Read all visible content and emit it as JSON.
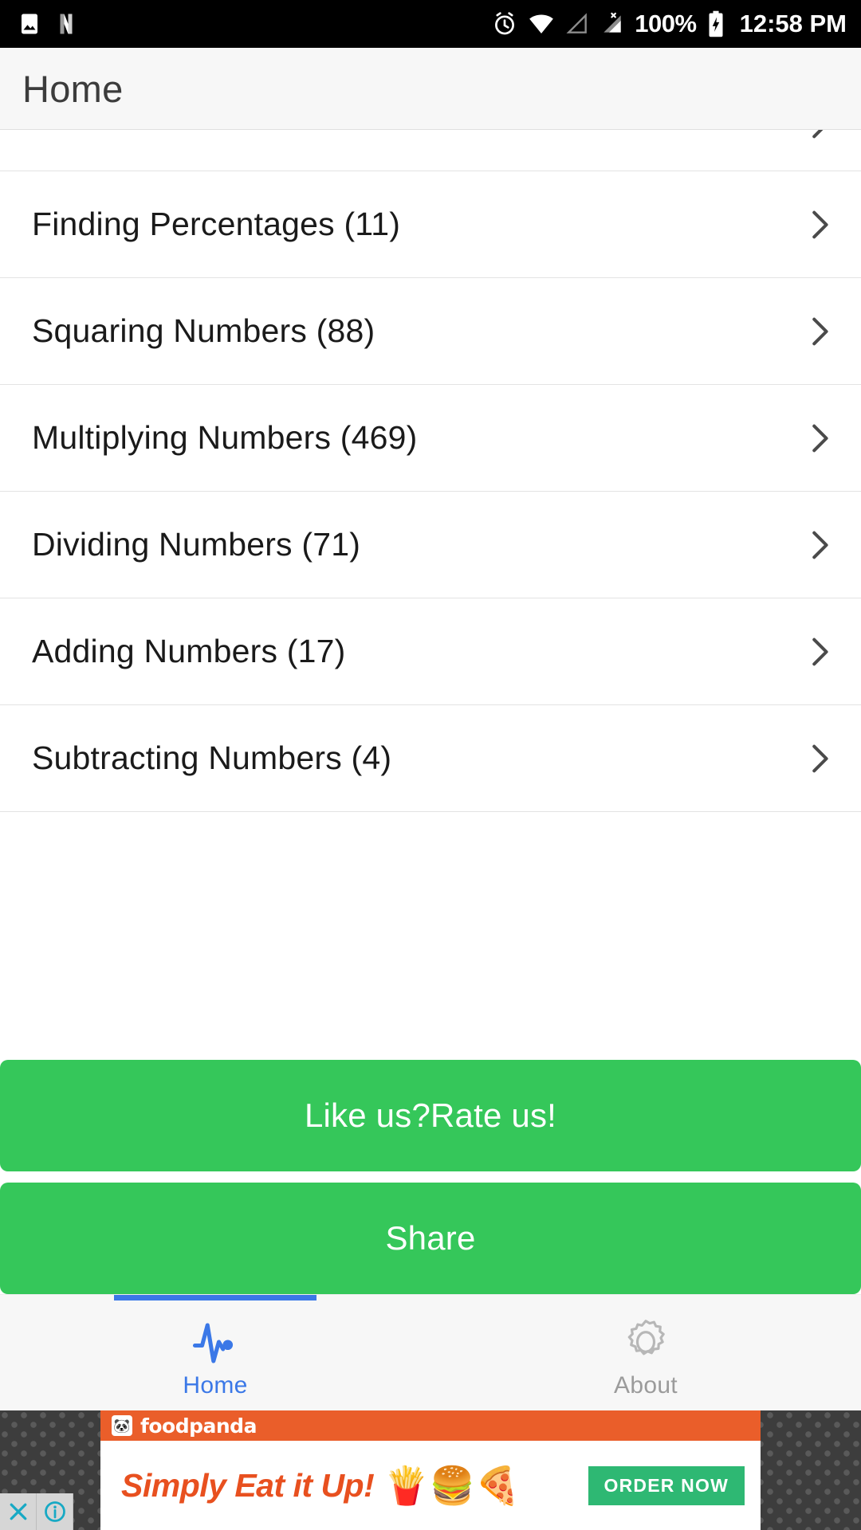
{
  "statusbar": {
    "icons_left": [
      "image-icon",
      "netflix-icon"
    ],
    "icons_right": [
      "alarm-icon",
      "wifi-icon",
      "signal-empty-icon",
      "signal-no-sim-icon"
    ],
    "battery_percent": "100%",
    "battery_icon": "battery-charging-icon",
    "time": "12:58 PM"
  },
  "appbar": {
    "title": "Home"
  },
  "list": {
    "clipped_top_row": {
      "label": "",
      "icon": "chevron-right-icon"
    },
    "rows": [
      {
        "label": "Finding Percentages (11)",
        "icon": "chevron-right-icon"
      },
      {
        "label": "Squaring Numbers (88)",
        "icon": "chevron-right-icon"
      },
      {
        "label": "Multiplying Numbers (469)",
        "icon": "chevron-right-icon"
      },
      {
        "label": "Dividing Numbers (71)",
        "icon": "chevron-right-icon"
      },
      {
        "label": "Adding Numbers (17)",
        "icon": "chevron-right-icon"
      },
      {
        "label": "Subtracting Numbers (4)",
        "icon": "chevron-right-icon"
      }
    ]
  },
  "actions": {
    "rate_label": "Like us?Rate us!",
    "share_label": "Share",
    "button_color": "#35c75a"
  },
  "tabbar": {
    "accent_color": "#3b78e7",
    "inactive_color": "#9b9b9b",
    "tabs": [
      {
        "label": "Home",
        "icon": "pulse-icon",
        "active": true
      },
      {
        "label": "About",
        "icon": "gear-icon",
        "active": false
      }
    ]
  },
  "ad": {
    "brand": "foodpanda",
    "brand_mark_icon": "panda-icon",
    "brand_bar_color": "#ea5e2a",
    "headline": "Simply  Eat it Up!",
    "headline_color": "#e8501f",
    "food_icons": [
      "fries-icon",
      "burger-icon",
      "pizza-icon"
    ],
    "cta_label": "ORDER NOW",
    "cta_color": "#2eb873",
    "close_icon": "close-icon",
    "info_icon": "info-icon"
  }
}
